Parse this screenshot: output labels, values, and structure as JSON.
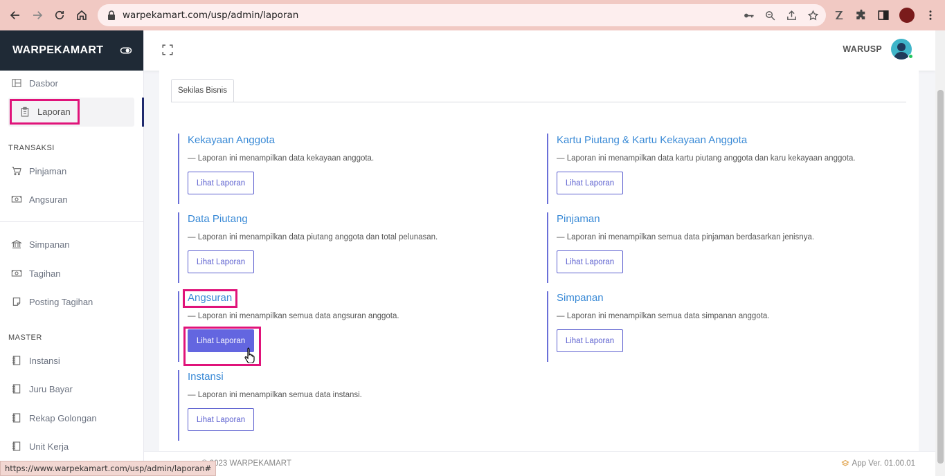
{
  "browser": {
    "url": "warpekamart.com/usp/admin/laporan",
    "status_url": "https://www.warpekamart.com/usp/admin/laporan#"
  },
  "sidebar": {
    "brand": "WARPEKAMART",
    "items": [
      {
        "label": "Dasbor",
        "icon": "dashboard-icon"
      },
      {
        "label": "Laporan",
        "icon": "clipboard-icon",
        "active": true
      }
    ],
    "section_transaksi": "TRANSAKSI",
    "transaksi_items": [
      {
        "label": "Pinjaman",
        "icon": "cart-icon"
      },
      {
        "label": "Angsuran",
        "icon": "money-icon"
      },
      {
        "label": "Simpanan",
        "icon": "bank-icon"
      },
      {
        "label": "Tagihan",
        "icon": "money-icon"
      },
      {
        "label": "Posting Tagihan",
        "icon": "note-icon"
      }
    ],
    "section_master": "MASTER",
    "master_items": [
      {
        "label": "Instansi",
        "icon": "book-icon"
      },
      {
        "label": "Juru Bayar",
        "icon": "book-icon"
      },
      {
        "label": "Rekap Golongan",
        "icon": "book-icon"
      },
      {
        "label": "Unit Kerja",
        "icon": "book-icon"
      }
    ]
  },
  "header": {
    "username": "WARUSP"
  },
  "main": {
    "tab": "Sekilas Bisnis",
    "button_label": "Lihat Laporan",
    "reports": [
      {
        "title": "Kekayaan Anggota",
        "desc": "— Laporan ini menampilkan data kekayaan anggota."
      },
      {
        "title": "Kartu Piutang & Kartu Kekayaan Anggota",
        "desc": "— Laporan ini menampilkan data kartu piutang anggota dan karu kekayaan anggota."
      },
      {
        "title": "Data Piutang",
        "desc": "— Laporan ini menampilkan data piutang anggota dan total pelunasan."
      },
      {
        "title": "Pinjaman",
        "desc": "— Laporan ini menampilkan semua data pinjaman berdasarkan jenisnya."
      },
      {
        "title": "Angsuran",
        "desc": "— Laporan ini menampilkan semua data angsuran anggota."
      },
      {
        "title": "Simpanan",
        "desc": "— Laporan ini menampilkan semua data simpanan anggota."
      },
      {
        "title": "Instansi",
        "desc": "— Laporan ini menampilkan semua data instansi."
      }
    ]
  },
  "footer": {
    "copyright": "© 2023 WARPEKAMART",
    "version": "App Ver. 01.00.01"
  },
  "colors": {
    "brand_bg": "#1f2a36",
    "accent": "#6366e0",
    "title_blue": "#3a8ad6",
    "highlight": "#e0137a"
  }
}
